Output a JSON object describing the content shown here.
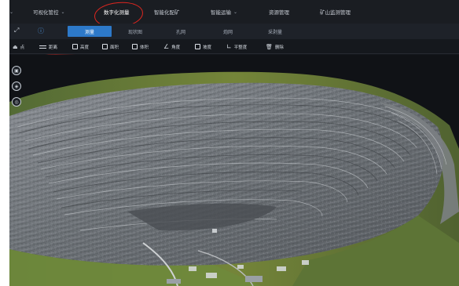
{
  "nav": {
    "items": [
      {
        "label": "可视化管控",
        "has_dropdown": true,
        "active": false
      },
      {
        "label": "数字化测量",
        "has_dropdown": false,
        "active": true
      },
      {
        "label": "智能化配矿",
        "has_dropdown": false,
        "active": false
      },
      {
        "label": "智能运输",
        "has_dropdown": true,
        "active": false
      },
      {
        "label": "资源管理",
        "has_dropdown": false,
        "active": false
      },
      {
        "label": "矿山监测管理",
        "has_dropdown": false,
        "active": false
      }
    ]
  },
  "tabs": {
    "items": [
      {
        "label": "测量",
        "active": true
      },
      {
        "label": "现状图",
        "active": false
      },
      {
        "label": "孔网",
        "active": false
      },
      {
        "label": "炮网",
        "active": false
      },
      {
        "label": "采剥量",
        "active": false
      }
    ]
  },
  "tools": {
    "items": [
      {
        "label": "点"
      },
      {
        "label": "距离"
      },
      {
        "label": "高度"
      },
      {
        "label": "面积"
      },
      {
        "label": "体积"
      },
      {
        "label": "角度"
      },
      {
        "label": "坡度"
      },
      {
        "label": "平整度"
      },
      {
        "label": "删除"
      }
    ]
  },
  "icons": {
    "nav_left": "chevron-down-icon",
    "expand": "expand-icon",
    "info": "info-icon",
    "side_tools": [
      "image-icon",
      "layers-icon",
      "compass-icon"
    ]
  },
  "colors": {
    "accent": "#2d79c9",
    "annotation": "#e0261f",
    "background": "#14171c"
  }
}
